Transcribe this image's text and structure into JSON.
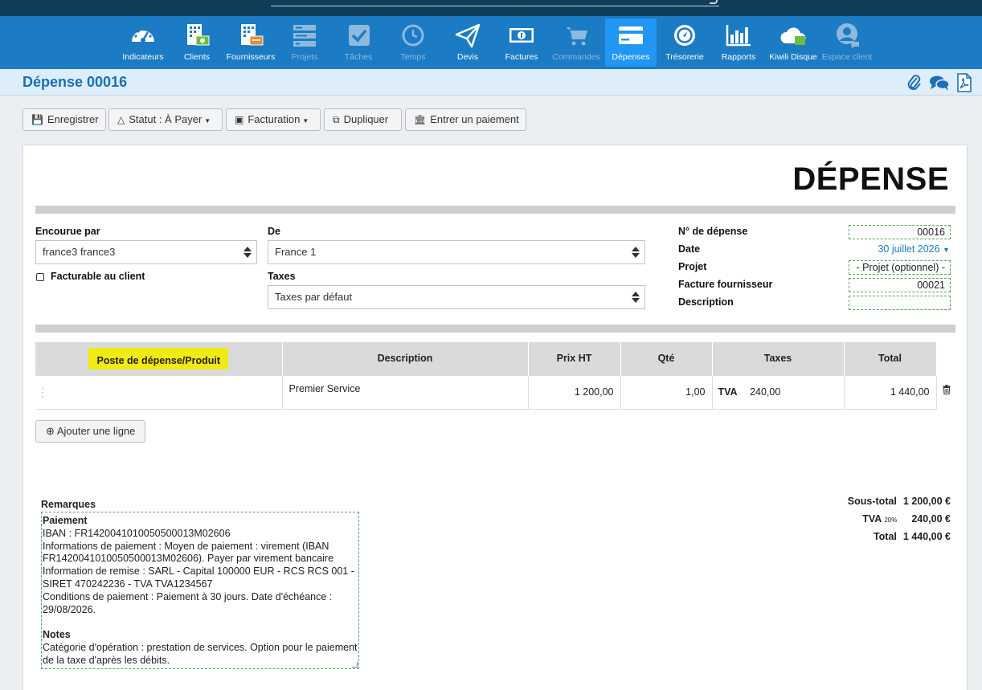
{
  "nav": {
    "items": [
      {
        "label": "Indicateurs",
        "icon": "dashboard-icon"
      },
      {
        "label": "Clients",
        "icon": "clients-icon"
      },
      {
        "label": "Fournisseurs",
        "icon": "suppliers-icon"
      },
      {
        "label": "Projets",
        "icon": "projects-icon"
      },
      {
        "label": "Tâches",
        "icon": "tasks-icon"
      },
      {
        "label": "Temps",
        "icon": "clock-icon"
      },
      {
        "label": "Devis",
        "icon": "paper-plane-icon"
      },
      {
        "label": "Factures",
        "icon": "banknote-icon"
      },
      {
        "label": "Commandes",
        "icon": "cart-icon"
      },
      {
        "label": "Dépenses",
        "icon": "credit-card-icon"
      },
      {
        "label": "Trésorerie",
        "icon": "compass-icon"
      },
      {
        "label": "Rapports",
        "icon": "bar-chart-icon"
      },
      {
        "label": "Kiwili Disque",
        "icon": "cloud-icon"
      },
      {
        "label": "Espace client",
        "icon": "user-icon"
      }
    ],
    "active": "Dépenses",
    "disabled": [
      "Projets",
      "Tâches",
      "Temps",
      "Commandes",
      "Espace client"
    ]
  },
  "page": {
    "title": "Dépense 00016"
  },
  "toolbar": {
    "save": "Enregistrer",
    "status": "Statut : À Payer",
    "billing": "Facturation",
    "duplicate": "Dupliquer",
    "payment": "Entrer un paiement"
  },
  "doc": {
    "heading": "DÉPENSE",
    "incurred_by_label": "Encourue par",
    "incurred_by_value": "france3 france3",
    "billable_label": "Facturable au client",
    "from_label": "De",
    "from_value": "France 1",
    "taxes_label": "Taxes",
    "taxes_value": "Taxes par défaut",
    "number_label": "N° de dépense",
    "number_value": "00016",
    "date_label": "Date",
    "date_value": "30 juillet 2026",
    "project_label": "Projet",
    "project_value": "- Projet (optionnel) -",
    "supplier_invoice_label": "Facture fournisseur",
    "supplier_invoice_value": "00021",
    "description_label": "Description",
    "description_value": ""
  },
  "table": {
    "headers": [
      "Poste de dépense/Produit",
      "Description",
      "Prix HT",
      "Qté",
      "Taxes",
      "Total"
    ],
    "rows": [
      {
        "product": "",
        "description": "Premier Service",
        "price": "1 200,00",
        "qty": "1,00",
        "tax_name": "TVA",
        "tax_amount": "240,00",
        "total": "1 440,00"
      }
    ],
    "add_line": "Ajouter une ligne"
  },
  "remarks": {
    "label": "Remarques",
    "payment_heading": "Paiement",
    "payment_text": "IBAN : FR1420041010050500013M02606\nInformations de paiement : Moyen de paiement : virement (IBAN FR1420041010050500013M02606). Payer par virement bancaire\nInformation de remise : SARL - Capital 100000 EUR - RCS RCS 001 - SIRET 470242236 - TVA TVA1234567\nConditions de paiement : Paiement à 30 jours. Date d'échéance : 29/08/2026.",
    "notes_heading": "Notes",
    "notes_text": "Catégorie d'opération : prestation de services. Option pour le paiement de la taxe d'après les débits."
  },
  "totals": {
    "subtotal_label": "Sous-total",
    "subtotal_value": "1 200,00 €",
    "tax_label": "TVA",
    "tax_rate": "20%",
    "tax_value": "240,00 €",
    "total_label": "Total",
    "total_value": "1 440,00 €"
  },
  "colors": {
    "nav_bg": "#1b7bc4",
    "nav_active": "#2196f3",
    "title": "#1b6fb3",
    "highlight": "#f1ea13"
  }
}
